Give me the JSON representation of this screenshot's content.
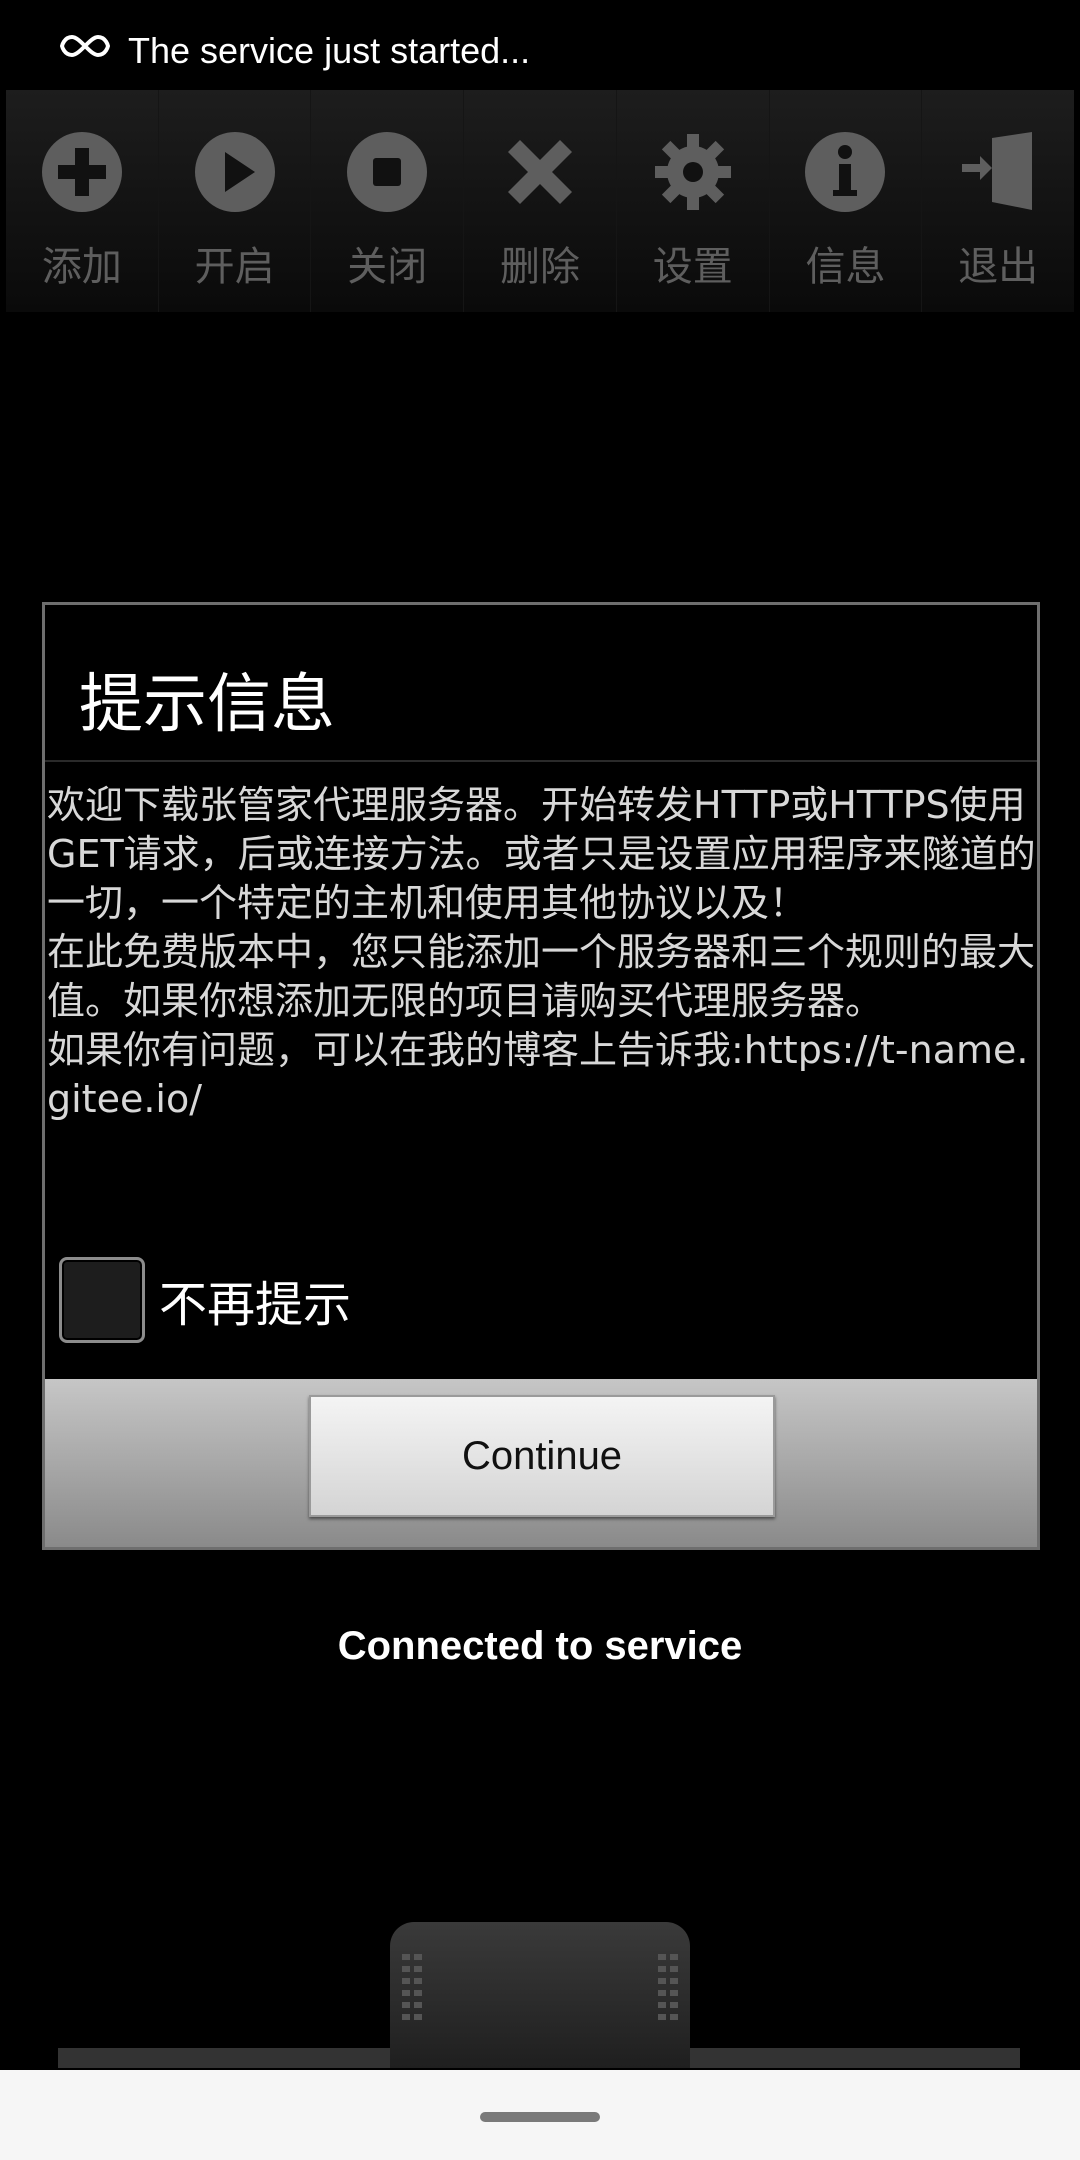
{
  "status_bar": {
    "text": "The service just started..."
  },
  "toolbar": {
    "items": [
      {
        "icon": "add-icon",
        "label": "添加"
      },
      {
        "icon": "play-icon",
        "label": "开启"
      },
      {
        "icon": "stop-icon",
        "label": "关闭"
      },
      {
        "icon": "delete-icon",
        "label": "删除"
      },
      {
        "icon": "gear-icon",
        "label": "设置"
      },
      {
        "icon": "info-icon",
        "label": "信息"
      },
      {
        "icon": "exit-icon",
        "label": "退出"
      }
    ]
  },
  "dialog": {
    "title": "提示信息",
    "body": "欢迎下载张管家代理服务器。开始转发HTTP或HTTPS使用GET请求，后或连接方法。或者只是设置应用程序来隧道的一切，一个特定的主机和使用其他协议以及！\n在此免费版本中，您只能添加一个服务器和三个规则的最大值。如果你想添加无限的项目请购买代理服务器。\n如果你有问题，可以在我的博客上告诉我:https://t-name.gitee.io/",
    "checkbox_label": "不再提示",
    "checkbox_checked": false,
    "button_label": "Continue"
  },
  "connection_status": "Connected to service",
  "colors": {
    "toolbar_icon": "#5e5e5e",
    "dialog_button_bg": "#a8a8a8"
  }
}
